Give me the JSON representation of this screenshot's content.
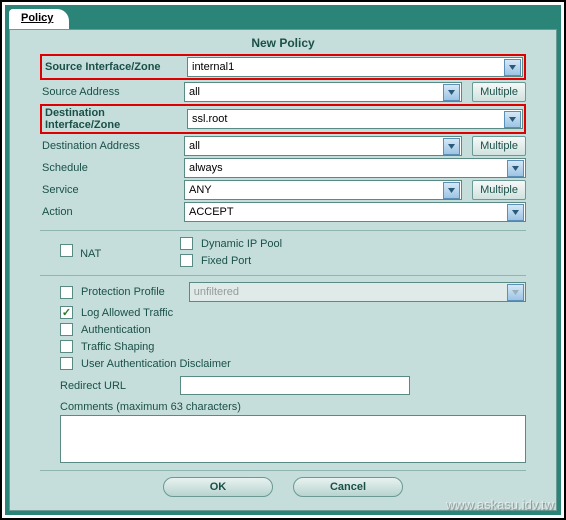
{
  "tab": {
    "label": "Policy"
  },
  "panel": {
    "title": "New Policy",
    "source_iface": {
      "label": "Source Interface/Zone",
      "value": "internal1"
    },
    "source_addr": {
      "label": "Source Address",
      "value": "all"
    },
    "dest_iface": {
      "label": "Destination Interface/Zone",
      "value": "ssl.root"
    },
    "dest_addr": {
      "label": "Destination Address",
      "value": "all"
    },
    "schedule": {
      "label": "Schedule",
      "value": "always"
    },
    "service": {
      "label": "Service",
      "value": "ANY"
    },
    "action": {
      "label": "Action",
      "value": "ACCEPT"
    },
    "multiple_btn": "Multiple"
  },
  "nat": {
    "label": "NAT",
    "dynamic_ip": "Dynamic IP Pool",
    "fixed_port": "Fixed Port"
  },
  "opts": {
    "protection_profile": {
      "label": "Protection Profile",
      "value": "unfiltered"
    },
    "log_allowed": "Log Allowed Traffic",
    "authentication": "Authentication",
    "traffic_shaping": "Traffic Shaping",
    "user_auth_disclaimer": "User Authentication Disclaimer"
  },
  "redirect": {
    "label": "Redirect URL",
    "value": ""
  },
  "comments": {
    "label": "Comments (maximum 63 characters)",
    "value": ""
  },
  "buttons": {
    "ok": "OK",
    "cancel": "Cancel"
  },
  "watermark": "www.askasu.idv.tw"
}
